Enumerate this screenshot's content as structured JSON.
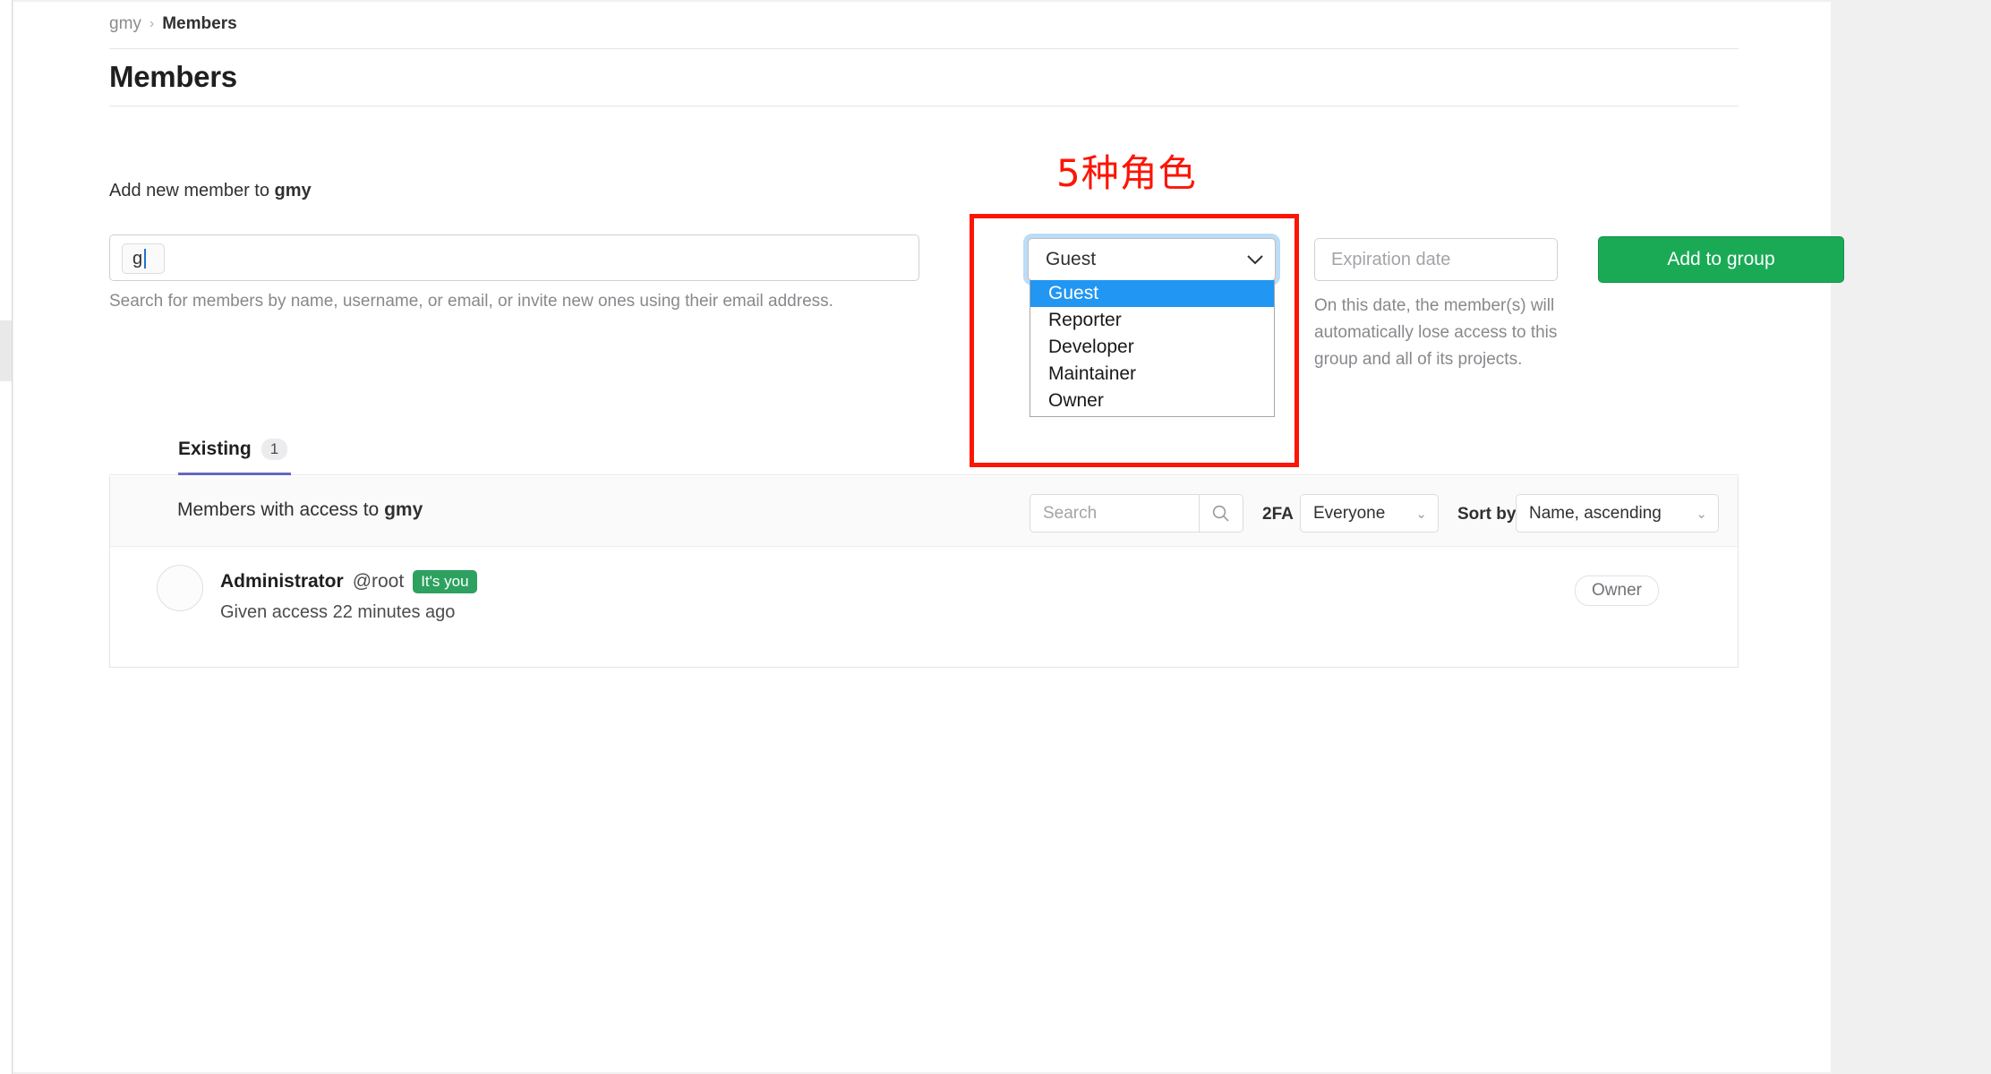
{
  "breadcrumb": {
    "group": "gmy",
    "separator": "›",
    "current": "Members"
  },
  "page_title": "Members",
  "add_member": {
    "label_prefix": "Add new member to ",
    "group_name": "gmy",
    "search_token_value": "g",
    "help_text": "Search for members by name, username, or email, or invite new ones using their email address."
  },
  "role_select": {
    "selected": "Guest",
    "options": [
      "Guest",
      "Reporter",
      "Developer",
      "Maintainer",
      "Owner"
    ],
    "highlighted_index": 0,
    "highlight_color": "#2196f3"
  },
  "annotation": {
    "text": "5种角色",
    "color": "#fc1505"
  },
  "expiration": {
    "placeholder": "Expiration date",
    "help_text": "On this date, the member(s) will automatically lose access to this group and all of its projects."
  },
  "add_to_group_button": {
    "label": "Add to group",
    "color": "#1aaa55"
  },
  "tabs": [
    {
      "label": "Existing",
      "count": "1",
      "active": true
    }
  ],
  "members_panel": {
    "title_prefix": "Members with access to ",
    "title_group": "gmy",
    "search_placeholder": "Search",
    "twofa_label": "2FA",
    "twofa_value": "Everyone",
    "sortby_label": "Sort by",
    "sortby_value": "Name, ascending",
    "rows": [
      {
        "name": "Administrator",
        "username": "@root",
        "badge": "It's you",
        "access": "Given access 22 minutes ago",
        "role": "Owner"
      }
    ]
  }
}
